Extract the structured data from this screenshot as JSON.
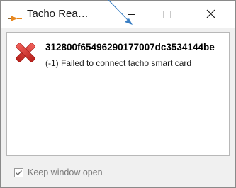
{
  "window": {
    "title": "Tacho Rea…",
    "controls": {
      "minimize": "minimize",
      "maximize": "maximize",
      "close": "close"
    }
  },
  "message": {
    "icon": "error-x-icon",
    "title": "312800f65496290177007dc3534144be",
    "body": "(-1) Failed to connect tacho smart card"
  },
  "footer": {
    "checkbox_label": "Keep window open",
    "checked": true
  },
  "colors": {
    "error_red": "#d9312b",
    "app_icon_orange": "#e8871e",
    "cursor_blue": "#3b7fc4"
  }
}
